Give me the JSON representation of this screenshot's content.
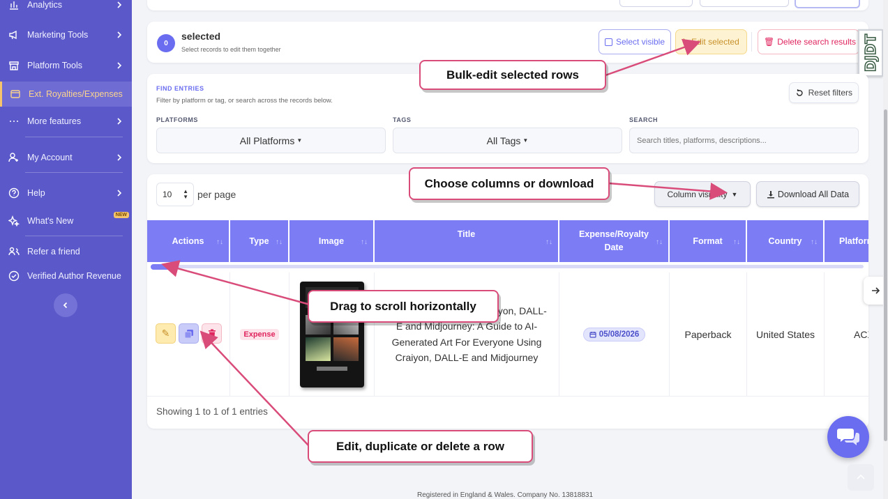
{
  "sidebar": {
    "items": [
      {
        "label": "Analytics",
        "icon": "bar-chart-icon"
      },
      {
        "label": "Marketing Tools",
        "icon": "megaphone-icon"
      },
      {
        "label": "Platform Tools",
        "icon": "store-icon"
      },
      {
        "label": "Ext. Royalties/Expenses",
        "icon": "wallet-icon",
        "active": true
      },
      {
        "label": "More features",
        "icon": "more-icon"
      },
      {
        "label": "My Account",
        "icon": "user-gear-icon"
      },
      {
        "label": "Help",
        "icon": "help-icon"
      },
      {
        "label": "What's New",
        "icon": "sparkle-icon",
        "badge": "NEW"
      },
      {
        "label": "Refer a friend",
        "icon": "users-icon"
      },
      {
        "label": "Verified Author Revenue",
        "icon": "check-circle-icon"
      }
    ]
  },
  "selection": {
    "count": "0",
    "title": "selected",
    "subtitle": "Select records to edit them together",
    "select_visible": "Select visible",
    "edit_selected": "Edit selected",
    "delete_results": "Delete search results"
  },
  "filters": {
    "heading": "FIND ENTRIES",
    "description": "Filter by platform or tag, or search across the records below.",
    "reset": "Reset filters",
    "platforms_label": "PLATFORMS",
    "platforms_value": "All Platforms",
    "tags_label": "TAGS",
    "tags_value": "All Tags",
    "search_label": "SEARCH",
    "search_placeholder": "Search titles, platforms, descriptions..."
  },
  "table_controls": {
    "per_page_value": "10",
    "per_page_label": "per page",
    "column_visibility": "Column visibility",
    "download": "Download All Data"
  },
  "table": {
    "columns": [
      "Actions",
      "Type",
      "Image",
      "Title",
      "Expense/Royalty Date",
      "Format",
      "Country",
      "Platform"
    ],
    "row": {
      "type": "Expense",
      "title": "Creating AI Art Using Craiyon, DALL-E and Midjourney: A Guide to AI-Generated Art For Everyone Using Craiyon, DALL-E and Midjourney",
      "date": "05/08/2026",
      "format": "Paperback",
      "country": "United States",
      "platform": "ACX"
    },
    "footer": "Showing 1 to 1 of 1 entries"
  },
  "callouts": {
    "bulk": "Bulk-edit selected rows",
    "columns": "Choose columns or download",
    "scroll": "Drag to scroll horizontally",
    "row_actions": "Edit, duplicate or delete a row"
  },
  "footer_text": "Registered in England & Wales. Company No. 13818831",
  "colors": {
    "sidebar": "#5b59c9",
    "accent": "#7c7cf5",
    "callout_border": "#d94c7a",
    "expense": "#e0245e"
  }
}
